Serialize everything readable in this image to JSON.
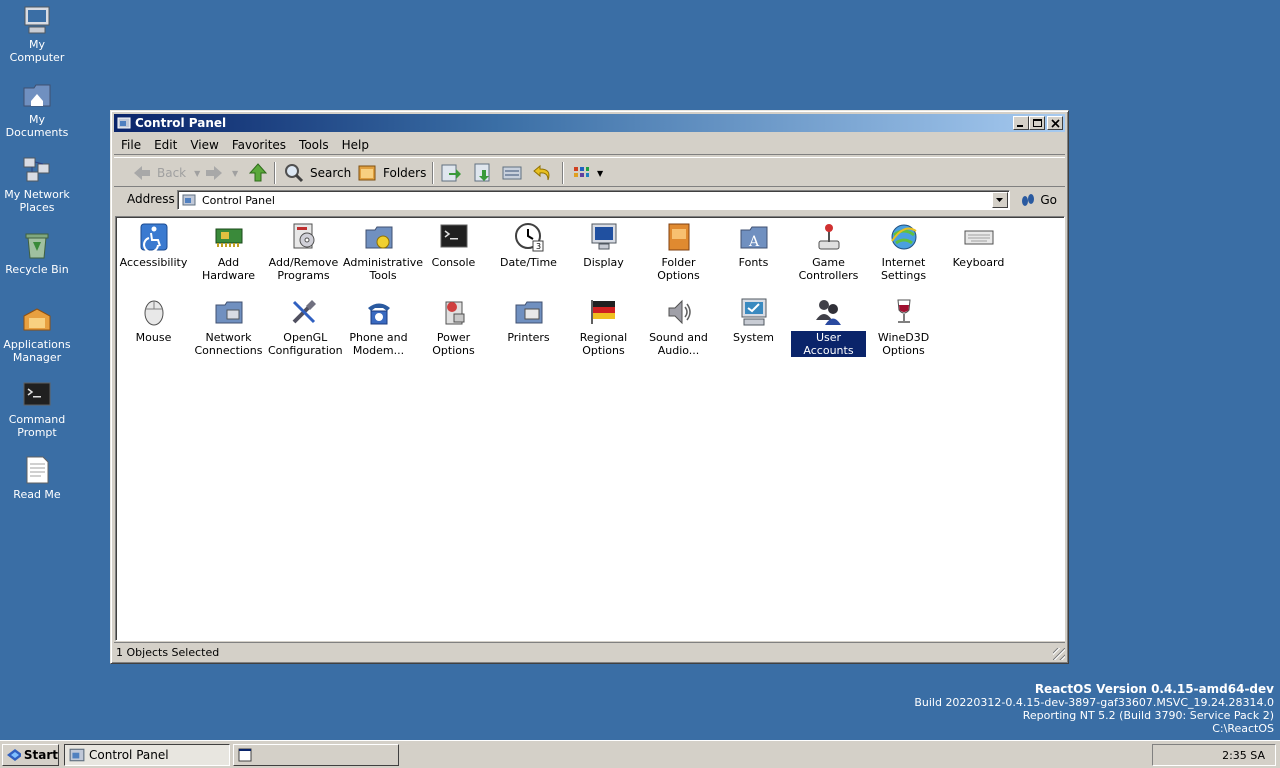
{
  "desktop": {
    "icons": [
      {
        "label": "My Computer",
        "icon": "computer-icon"
      },
      {
        "label": "My Documents",
        "icon": "documents-icon"
      },
      {
        "label": "My Network Places",
        "icon": "network-places-icon"
      },
      {
        "label": "Recycle Bin",
        "icon": "recycle-bin-icon"
      },
      {
        "label": "Applications Manager",
        "icon": "applications-manager-icon"
      },
      {
        "label": "Command Prompt",
        "icon": "command-prompt-icon"
      },
      {
        "label": "Read Me",
        "icon": "readme-icon"
      }
    ]
  },
  "window": {
    "title": "Control Panel",
    "menu": [
      "File",
      "Edit",
      "View",
      "Favorites",
      "Tools",
      "Help"
    ],
    "toolbar": {
      "back": "Back",
      "search": "Search",
      "folders": "Folders"
    },
    "address": {
      "label": "Address",
      "value": "Control Panel",
      "go": "Go"
    },
    "items": [
      {
        "label": "Accessibility",
        "icon": "accessibility-icon"
      },
      {
        "label": "Add Hardware",
        "icon": "hardware-icon"
      },
      {
        "label": "Add/Remove Programs",
        "icon": "programs-icon"
      },
      {
        "label": "Administrative Tools",
        "icon": "admin-tools-icon"
      },
      {
        "label": "Console",
        "icon": "console-icon"
      },
      {
        "label": "Date/Time",
        "icon": "clock-icon"
      },
      {
        "label": "Display",
        "icon": "display-icon"
      },
      {
        "label": "Folder Options",
        "icon": "folder-options-icon"
      },
      {
        "label": "Fonts",
        "icon": "fonts-icon"
      },
      {
        "label": "Game Controllers",
        "icon": "joystick-icon"
      },
      {
        "label": "Internet Settings",
        "icon": "internet-icon"
      },
      {
        "label": "Keyboard",
        "icon": "keyboard-icon"
      },
      {
        "label": "Mouse",
        "icon": "mouse-icon"
      },
      {
        "label": "Network Connections",
        "icon": "network-icon"
      },
      {
        "label": "OpenGL Configuration",
        "icon": "opengl-icon"
      },
      {
        "label": "Phone and Modem...",
        "icon": "phone-icon"
      },
      {
        "label": "Power Options",
        "icon": "power-icon"
      },
      {
        "label": "Printers",
        "icon": "printer-icon"
      },
      {
        "label": "Regional Options",
        "icon": "flag-icon"
      },
      {
        "label": "Sound and Audio...",
        "icon": "speaker-icon"
      },
      {
        "label": "System",
        "icon": "system-icon"
      },
      {
        "label": "User Accounts",
        "icon": "users-icon",
        "selected": true
      },
      {
        "label": "WineD3D Options",
        "icon": "wine-icon"
      }
    ],
    "status": "1 Objects Selected"
  },
  "version": {
    "title": "ReactOS Version 0.4.15-amd64-dev",
    "build": "Build 20220312-0.4.15-dev-3897-gaf33607.MSVC_19.24.28314.0",
    "reporting": "Reporting NT 5.2 (Build 3790: Service Pack 2)",
    "path": "C:\\ReactOS"
  },
  "taskbar": {
    "start": "Start",
    "tasks": [
      "Control Panel",
      ""
    ],
    "clock": "2:35 SA"
  },
  "colors": {
    "desktop": "#3a6ea5",
    "titlebar": "#0a246a",
    "selection": "#0a246a"
  }
}
